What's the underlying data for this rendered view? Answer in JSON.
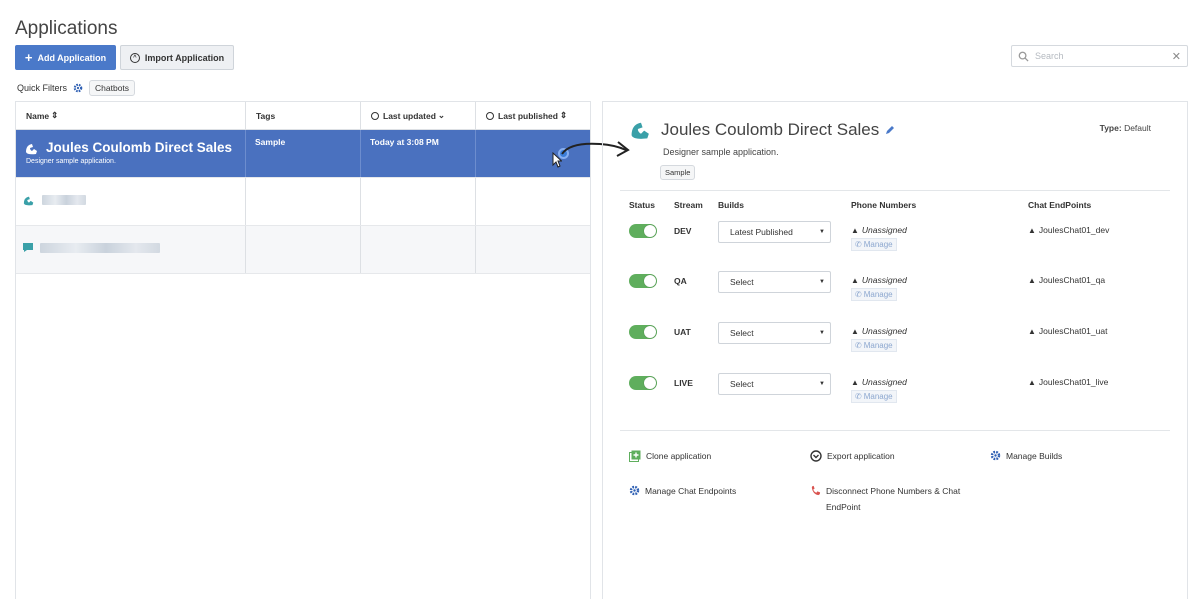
{
  "page": {
    "title": "Applications"
  },
  "toolbar": {
    "add_label": "Add Application",
    "import_label": "Import Application"
  },
  "search": {
    "placeholder": "Search"
  },
  "quick_filters": {
    "label": "Quick Filters",
    "chips": [
      "Chatbots"
    ]
  },
  "list": {
    "columns": {
      "name": "Name",
      "tags": "Tags",
      "last_updated": "Last updated",
      "last_published": "Last published"
    },
    "rows": [
      {
        "name": "Joules Coulomb Direct Sales",
        "description": "Designer sample application.",
        "tags": "Sample",
        "last_updated": "Today at 3:08 PM",
        "last_published": ""
      }
    ]
  },
  "detail": {
    "title": "Joules Coulomb Direct Sales",
    "type_label": "Type:",
    "type_value": "Default",
    "description": "Designer sample application.",
    "tag": "Sample",
    "headers": {
      "status": "Status",
      "stream": "Stream",
      "builds": "Builds",
      "phone_numbers": "Phone Numbers",
      "chat_endpoints": "Chat EndPoints"
    },
    "streams": [
      {
        "name": "DEV",
        "enabled": true,
        "build": "Latest Published",
        "phone": "Unassigned",
        "manage": "Manage",
        "endpoint": "JoulesChat01_dev"
      },
      {
        "name": "QA",
        "enabled": true,
        "build": "Select",
        "phone": "Unassigned",
        "manage": "Manage",
        "endpoint": "JoulesChat01_qa"
      },
      {
        "name": "UAT",
        "enabled": true,
        "build": "Select",
        "phone": "Unassigned",
        "manage": "Manage",
        "endpoint": "JoulesChat01_uat"
      },
      {
        "name": "LIVE",
        "enabled": true,
        "build": "Select",
        "phone": "Unassigned",
        "manage": "Manage",
        "endpoint": "JoulesChat01_live"
      }
    ],
    "actions": {
      "clone": "Clone application",
      "export": "Export application",
      "manage_builds": "Manage Builds",
      "manage_chat": "Manage Chat Endpoints",
      "disconnect": "Disconnect Phone Numbers & Chat EndPoint"
    }
  },
  "colors": {
    "accent": "#4a79c9",
    "selected_row": "#4a71bf",
    "toggle_on": "#5fae5d",
    "icon_teal": "#3aa0a8",
    "disconnect_red": "#d9534f",
    "clone_green": "#5fae5d"
  }
}
